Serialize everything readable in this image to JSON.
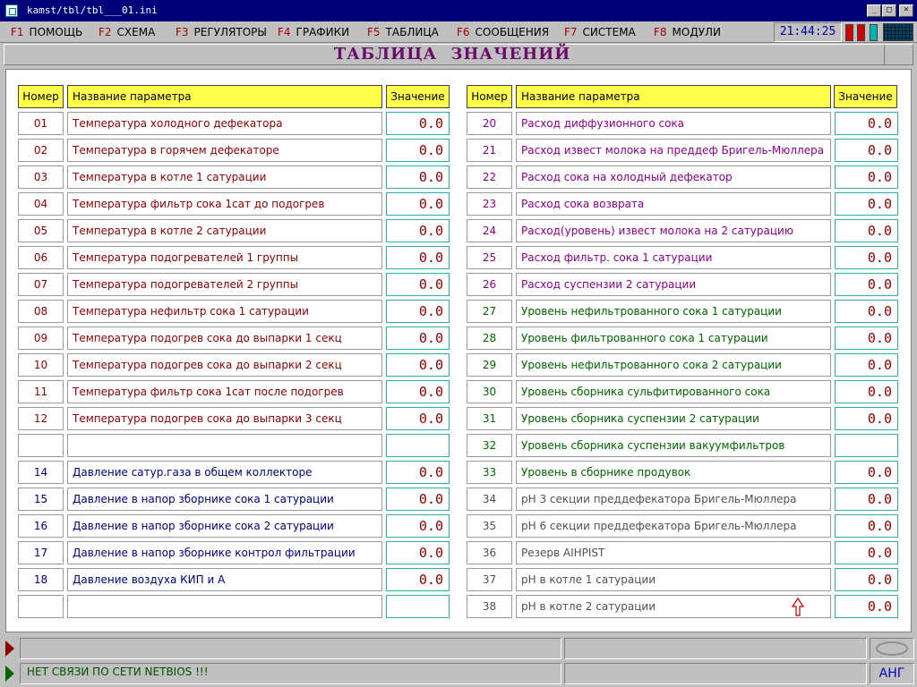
{
  "window": {
    "title": "kamst/tbl/tbl___01.ini"
  },
  "menu": [
    {
      "key": "F1",
      "label": "ПОМОЩЬ"
    },
    {
      "key": "F2",
      "label": "СХЕМА"
    },
    {
      "key": "F3",
      "label": "РЕГУЛЯТОРЫ"
    },
    {
      "key": "F4",
      "label": "ГРАФИКИ"
    },
    {
      "key": "F5",
      "label": "ТАБЛИЦА"
    },
    {
      "key": "F6",
      "label": "СООБЩЕНИЯ"
    },
    {
      "key": "F7",
      "label": "СИСТЕМА"
    },
    {
      "key": "F8",
      "label": "МОДУЛИ"
    }
  ],
  "clock": "21:44:25",
  "header": {
    "title": "ТАБЛИЦА ЗНАЧЕНИЙ"
  },
  "columns": {
    "num": "Номер",
    "name": "Название параметра",
    "value": "Значение"
  },
  "left_rows": [
    {
      "num": "01",
      "name": "Температура холодного дефекатора",
      "value": "0.0",
      "color": "#8b0000"
    },
    {
      "num": "02",
      "name": "Температура в горячем дефекаторе",
      "value": "0.0",
      "color": "#8b0000"
    },
    {
      "num": "03",
      "name": "Температура в котле 1 сатурации",
      "value": "0.0",
      "color": "#8b0000"
    },
    {
      "num": "04",
      "name": "Температура фильтр сока 1сат до подогрев",
      "value": "0.0",
      "color": "#8b0000"
    },
    {
      "num": "05",
      "name": "Температура в котле 2 сатурации",
      "value": "0.0",
      "color": "#8b0000"
    },
    {
      "num": "06",
      "name": "Температура подогревателей 1 группы",
      "value": "0.0",
      "color": "#8b0000"
    },
    {
      "num": "07",
      "name": "Температура подогревателей 2 группы",
      "value": "0.0",
      "color": "#8b0000"
    },
    {
      "num": "08",
      "name": "Температура нефильтр сока 1 сатурации",
      "value": "0.0",
      "color": "#8b0000"
    },
    {
      "num": "09",
      "name": "Температура подогрев сока до выпарки 1 секц",
      "value": "0.0",
      "color": "#8b0000"
    },
    {
      "num": "10",
      "name": "Температура подогрев сока до выпарки 2 секц",
      "value": "0.0",
      "color": "#8b0000"
    },
    {
      "num": "11",
      "name": "Температура фильтр сока 1сат после подогрев",
      "value": "0.0",
      "color": "#8b0000"
    },
    {
      "num": "12",
      "name": "Температура подогрев сока до выпарки 3 секц",
      "value": "0.0",
      "color": "#8b0000"
    },
    {
      "num": "",
      "name": "",
      "value": "",
      "color": "#000080"
    },
    {
      "num": "14",
      "name": "Давление сатур.газа в общем коллекторе",
      "value": "0.0",
      "color": "#000080"
    },
    {
      "num": "15",
      "name": "Давление в напор зборнике сока 1 сатурации",
      "value": "0.0",
      "color": "#000080"
    },
    {
      "num": "16",
      "name": "Давление в напор зборнике сока 2 сатурации",
      "value": "0.0",
      "color": "#000080"
    },
    {
      "num": "17",
      "name": "Давление в напор зборнике контрол фильтрации",
      "value": "0.0",
      "color": "#000080"
    },
    {
      "num": "18",
      "name": "Давление воздуха КИП и А",
      "value": "0.0",
      "color": "#000080"
    },
    {
      "num": "",
      "name": "",
      "value": "",
      "color": "#000080"
    }
  ],
  "right_rows": [
    {
      "num": "20",
      "name": "Расход диффузионного сока",
      "value": "0.0",
      "color": "#8b008b"
    },
    {
      "num": "21",
      "name": "Расход извест молока на преддеф Бригель-Мюллера",
      "value": "0.0",
      "color": "#8b008b"
    },
    {
      "num": "22",
      "name": "Расход сока на холодный дефекатор",
      "value": "0.0",
      "color": "#8b008b"
    },
    {
      "num": "23",
      "name": "Расход сока возврата",
      "value": "0.0",
      "color": "#8b008b"
    },
    {
      "num": "24",
      "name": "Расход(уровень) извест молока на 2 сатурацию",
      "value": "0.0",
      "color": "#8b008b"
    },
    {
      "num": "25",
      "name": "Расход фильтр. сока 1 сатурации",
      "value": "0.0",
      "color": "#8b008b"
    },
    {
      "num": "26",
      "name": "Расход суспензии 2 сатурации",
      "value": "0.0",
      "color": "#8b008b"
    },
    {
      "num": "27",
      "name": "Уровень нефильтрованного сока 1 сатурации",
      "value": "0.0",
      "color": "#006400"
    },
    {
      "num": "28",
      "name": "Уровень фильтрованного сока 1 сатурации",
      "value": "0.0",
      "color": "#006400"
    },
    {
      "num": "29",
      "name": "Уровень нефильтрованного сока 2 сатурации",
      "value": "0.0",
      "color": "#006400"
    },
    {
      "num": "30",
      "name": "Уровень сборника сульфитированного сока",
      "value": "0.0",
      "color": "#006400"
    },
    {
      "num": "31",
      "name": "Уровень сборника суспензии 2 сатурации",
      "value": "0.0",
      "color": "#006400"
    },
    {
      "num": "32",
      "name": "Уровень сборника суспензии вакуумфильтров",
      "value": "",
      "color": "#006400"
    },
    {
      "num": "33",
      "name": "Уровень в сборнике продувок",
      "value": "0.0",
      "color": "#006400"
    },
    {
      "num": "34",
      "name": "pH 3 секции преддефекатора Бригель-Мюллера",
      "value": "0.0",
      "color": "#505050"
    },
    {
      "num": "35",
      "name": "pH 6 секции преддефекатора Бригель-Мюллера",
      "value": "0.0",
      "color": "#505050"
    },
    {
      "num": "36",
      "name": "Резерв AIHPIST",
      "value": "0.0",
      "color": "#505050"
    },
    {
      "num": "37",
      "name": "pH в котле 1 сатурации",
      "value": "0.0",
      "color": "#505050"
    },
    {
      "num": "38",
      "name": "pH в котле 2 сатурации",
      "value": "0.0",
      "color": "#505050"
    }
  ],
  "value_color": "#8b0000",
  "status": {
    "network_message": "НЕТ СВЯЗИ ПО СЕТИ NETBIOS !!!",
    "language": "АНГ"
  },
  "indicators": [
    "#cc0000",
    "#cc0000",
    "#00b3b3"
  ],
  "icons": {
    "app": "app-icon",
    "cursor": "pointer-arrow-icon"
  }
}
